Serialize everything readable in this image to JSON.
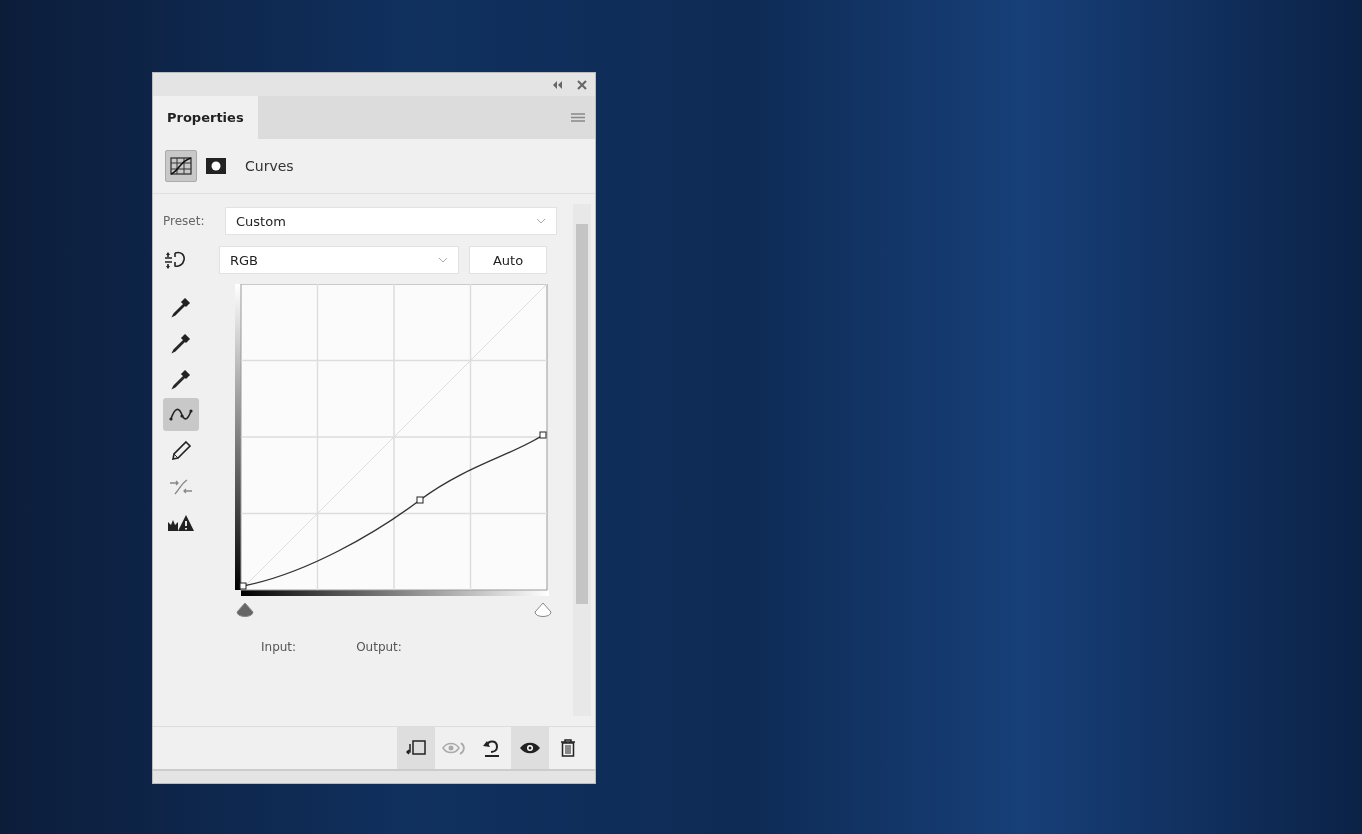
{
  "panel": {
    "tab": {
      "label": "Properties",
      "selected": true
    },
    "header_icons": [
      {
        "kind": "adjustment",
        "selected": true
      },
      {
        "kind": "mask",
        "selected": false
      }
    ],
    "title": "Curves",
    "preset": {
      "label": "Preset:",
      "value": "Custom"
    },
    "channel": {
      "value": "RGB"
    },
    "auto_button": "Auto",
    "tools": [
      {
        "kind": "black-dropper",
        "selected": false
      },
      {
        "kind": "gray-dropper",
        "selected": false
      },
      {
        "kind": "white-dropper",
        "selected": false
      },
      {
        "kind": "point",
        "selected": true
      },
      {
        "kind": "pencil",
        "selected": false
      },
      {
        "kind": "smooth",
        "selected": false
      },
      {
        "kind": "warning",
        "selected": false
      }
    ],
    "input_sliders": [
      {
        "kind": "shadow"
      },
      {
        "kind": "highlight"
      }
    ],
    "input_label": "Input:",
    "output_label": "Output:",
    "footer_buttons": [
      {
        "kind": "clip",
        "on": true
      },
      {
        "kind": "view-previous",
        "on": false
      },
      {
        "kind": "reset",
        "on": false
      },
      {
        "kind": "visibility",
        "on": true
      },
      {
        "kind": "delete",
        "on": false
      }
    ]
  }
}
